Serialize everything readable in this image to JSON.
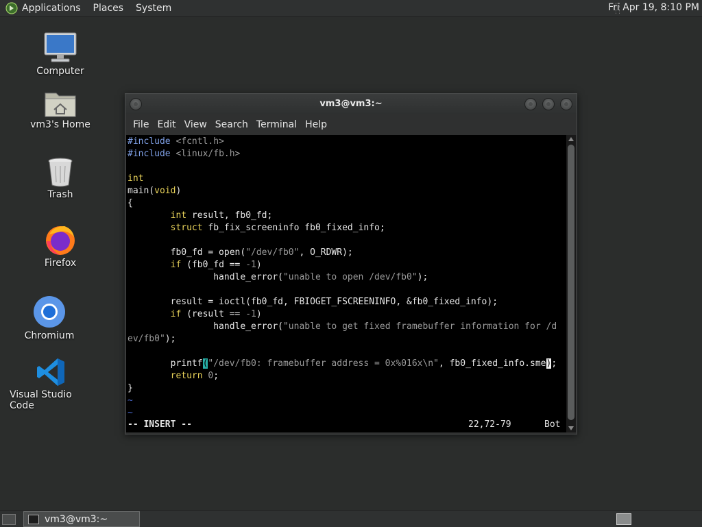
{
  "top_panel": {
    "menus": [
      "Applications",
      "Places",
      "System"
    ],
    "clock": "Fri Apr 19,  8:10 PM"
  },
  "desktop_icons": [
    {
      "label": "Computer",
      "icon": "computer-icon"
    },
    {
      "label": "vm3's Home",
      "icon": "home-folder-icon"
    },
    {
      "label": "Trash",
      "icon": "trash-icon"
    },
    {
      "label": "Firefox",
      "icon": "firefox-icon"
    },
    {
      "label": "Chromium",
      "icon": "chromium-icon"
    },
    {
      "label": "Visual Studio Code",
      "icon": "vscode-icon"
    }
  ],
  "window": {
    "title": "vm3@vm3:~",
    "menus": [
      "File",
      "Edit",
      "View",
      "Search",
      "Terminal",
      "Help"
    ]
  },
  "editor": {
    "lines": [
      "#include <fcntl.h>",
      "#include <linux/fb.h>",
      "",
      "int",
      "main(void)",
      "{",
      "        int result, fb0_fd;",
      "        struct fb_fix_screeninfo fb0_fixed_info;",
      "",
      "        fb0_fd = open(\"/dev/fb0\", O_RDWR);",
      "        if (fb0_fd == -1)",
      "                handle_error(\"unable to open /dev/fb0\");",
      "",
      "        result = ioctl(fb0_fd, FBIOGET_FSCREENINFO, &fb0_fixed_info);",
      "        if (result == -1)",
      "                handle_error(\"unable to get fixed framebuffer information for /d",
      "ev/fb0\");",
      "",
      "        printf(\"/dev/fb0: framebuffer address = 0x%016x\\n\", fb0_fixed_info.sme);",
      "        return 0;",
      "}",
      "~",
      "~"
    ],
    "mode": "-- INSERT --",
    "position": "22,72-79",
    "scroll": "Bot"
  },
  "taskbar": {
    "task_label": "vm3@vm3:~"
  },
  "colors": {
    "keyword": "#e9d35a",
    "preprocessor": "#7fa0e6",
    "string": "#9a9a9a",
    "tilde": "#4a6ad0",
    "match_paren": "#27b0a8"
  }
}
